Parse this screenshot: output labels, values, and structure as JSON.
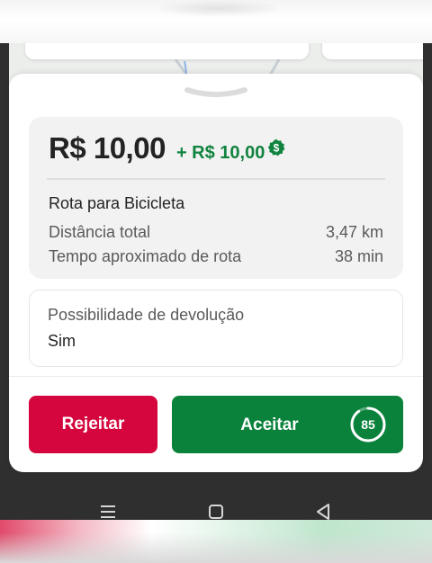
{
  "offer": {
    "price": "R$ 10,00",
    "bonus": "+ R$ 10,00",
    "bonus_icon": "dollar-coin-icon",
    "route_title": "Rota para Bicicleta",
    "distance_label": "Distância total",
    "distance_value": "3,47 km",
    "time_label": "Tempo aproximado de rota",
    "time_value": "38 min"
  },
  "return_info": {
    "label": "Possibilidade de devolução",
    "value": "Sim"
  },
  "actions": {
    "reject_label": "Rejeitar",
    "accept_label": "Aceitar",
    "countdown": "85",
    "countdown_progress": 0.9
  },
  "system_nav": {
    "icons": [
      "menu-icon",
      "home-icon",
      "back-icon"
    ]
  },
  "colors": {
    "accent_green": "#0a823c",
    "reject_red": "#d4063d",
    "bonus_green": "#11833f"
  }
}
